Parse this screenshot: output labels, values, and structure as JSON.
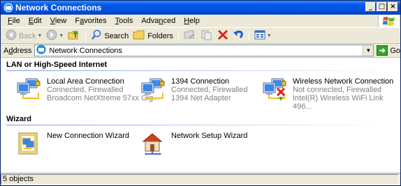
{
  "window": {
    "title": "Network Connections"
  },
  "window_buttons": {
    "minimize": "_",
    "maximize": "□",
    "close": "×"
  },
  "menu": [
    {
      "label": "File",
      "accel": "F",
      "rest": "ile"
    },
    {
      "label": "Edit",
      "accel": "E",
      "rest": "dit"
    },
    {
      "label": "View",
      "accel": "V",
      "rest": "iew"
    },
    {
      "label": "Favorites",
      "pre": "F",
      "accel": "a",
      "rest": "vorites"
    },
    {
      "label": "Tools",
      "accel": "T",
      "rest": "ools"
    },
    {
      "label": "Advanced",
      "pre": "Adva",
      "accel": "n",
      "rest": "ced"
    },
    {
      "label": "Help",
      "accel": "H",
      "rest": "elp"
    }
  ],
  "toolbar": {
    "back_label": "Back",
    "search_label": "Search",
    "folders_label": "Folders"
  },
  "address": {
    "label": "Address",
    "accel": "d",
    "value": "Network Connections",
    "go_label": "Go"
  },
  "groups": {
    "lan": {
      "title": "LAN or High-Speed Internet",
      "items": [
        {
          "name": "Local Area Connection",
          "status": "Connected, Firewalled",
          "device": "Broadcom NetXtreme 57xx Gig..."
        },
        {
          "name": "1394 Connection",
          "status": "Connected, Firewalled",
          "device": "1394 Net Adapter"
        },
        {
          "name": "Wireless Network Connection",
          "status": "Not connected, Firewalled",
          "device": "Intel(R) Wireless WiFi Link 496..."
        }
      ]
    },
    "wizard": {
      "title": "Wizard",
      "items": [
        {
          "name": "New Connection Wizard"
        },
        {
          "name": "Network Setup Wizard"
        }
      ]
    }
  },
  "status": {
    "text": "5 objects"
  },
  "colors": {
    "titlebar": "#0058ee",
    "chrome": "#ece9d8",
    "go_green": "#2ea52e",
    "group_line": "#7a96df"
  },
  "icons": [
    "network-connections-icon",
    "windows-logo-icon",
    "back-icon",
    "forward-icon",
    "up-folder-icon",
    "search-icon",
    "folders-icon",
    "move-to-icon",
    "copy-to-icon",
    "delete-icon",
    "undo-icon",
    "views-icon",
    "lan-connection-icon",
    "wireless-connection-icon",
    "new-connection-wizard-icon",
    "network-setup-wizard-icon"
  ]
}
